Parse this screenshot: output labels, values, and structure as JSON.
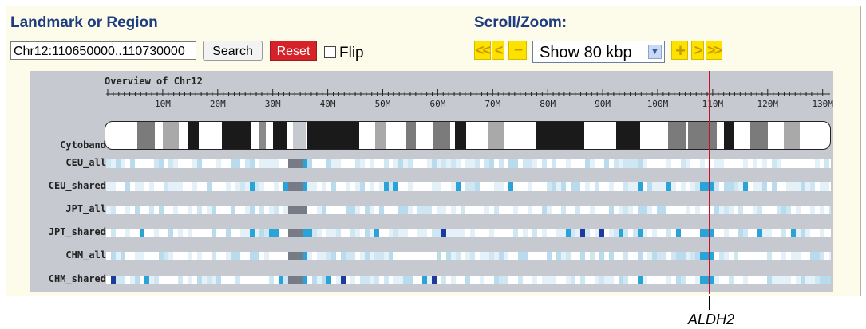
{
  "landmark": {
    "label": "Landmark or Region",
    "value": "Chr12:110650000..110730000",
    "search_label": "Search",
    "reset_label": "Reset",
    "flip_label": "Flip"
  },
  "scrollzoom": {
    "label": "Scroll/Zoom:",
    "left_far": "<<",
    "left": "<",
    "minus": "–",
    "select_value": "Show 80 kbp",
    "plus": "+",
    "right": ">",
    "right_far": ">>"
  },
  "overview": {
    "title": "Overview of Chr12",
    "ticks": [
      "10M",
      "20M",
      "30M",
      "40M",
      "50M",
      "60M",
      "70M",
      "80M",
      "90M",
      "100M",
      "110M",
      "120M",
      "130M"
    ]
  },
  "tracks": {
    "cytoband": "Cytoband",
    "names": [
      "CEU_all",
      "CEU_shared",
      "JPT_all",
      "JPT_shared",
      "CHM_all",
      "CHM_shared"
    ]
  },
  "annotation": {
    "gene": "ALDH2"
  },
  "colors": {
    "accent_label": "#1e3d80",
    "reset_red": "#d6232a",
    "zoom_yellow": "#fde200",
    "marker_red": "#c8102e"
  }
}
